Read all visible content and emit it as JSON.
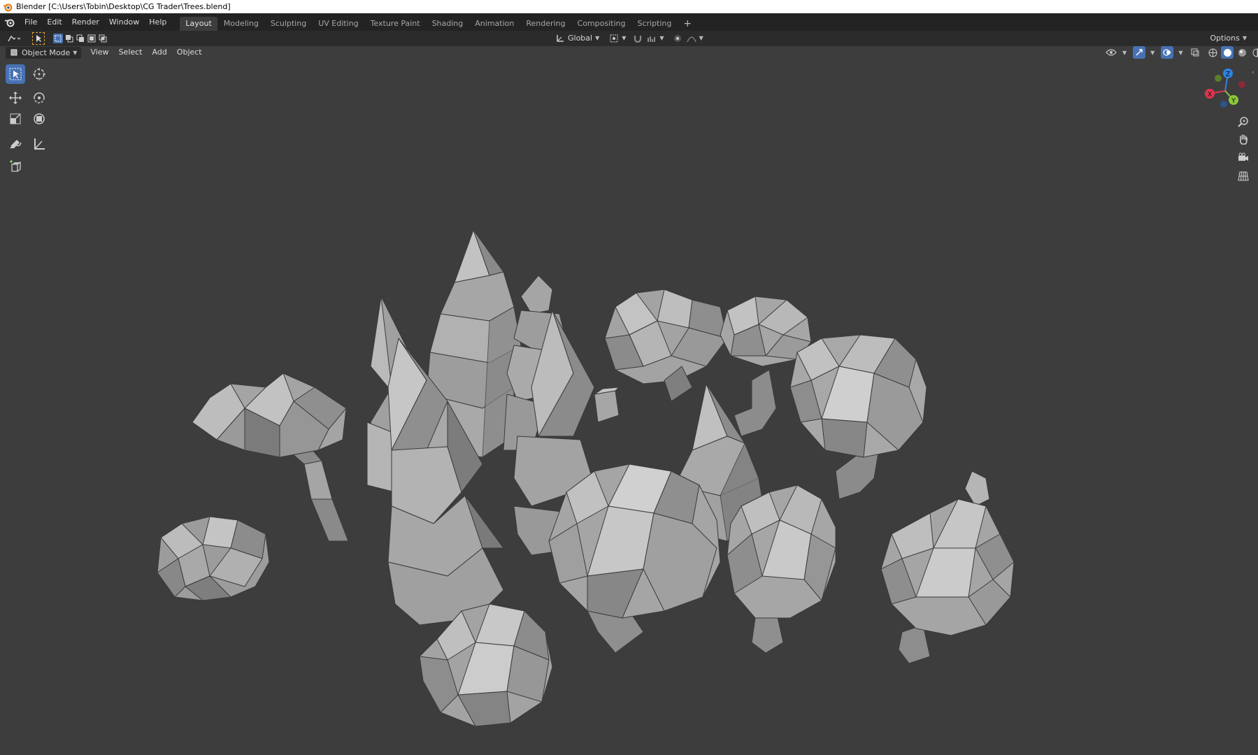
{
  "window": {
    "title": "Blender [C:\\Users\\Tobin\\Desktop\\CG Trader\\Trees.blend]"
  },
  "menu": {
    "file": "File",
    "edit": "Edit",
    "render": "Render",
    "window": "Window",
    "help": "Help"
  },
  "workspaces": [
    {
      "label": "Layout"
    },
    {
      "label": "Modeling"
    },
    {
      "label": "Sculpting"
    },
    {
      "label": "UV Editing"
    },
    {
      "label": "Texture Paint"
    },
    {
      "label": "Shading"
    },
    {
      "label": "Animation"
    },
    {
      "label": "Rendering"
    },
    {
      "label": "Compositing"
    },
    {
      "label": "Scripting"
    }
  ],
  "active_workspace": "Layout",
  "tool_header": {
    "orientation": "Global",
    "options": "Options"
  },
  "viewport_header": {
    "mode": "Object Mode",
    "view": "View",
    "select": "Select",
    "add": "Add",
    "object": "Object"
  },
  "gizmo": {
    "z": "Z",
    "x": "X",
    "y": "Y"
  },
  "colors": {
    "accent": "#4772b3",
    "background": "#3d3d3d",
    "header": "#232323",
    "mesh": "#9e9e9e",
    "x_axis": "#e0344e",
    "y_axis": "#8bc63d",
    "z_axis": "#2f84e3"
  }
}
